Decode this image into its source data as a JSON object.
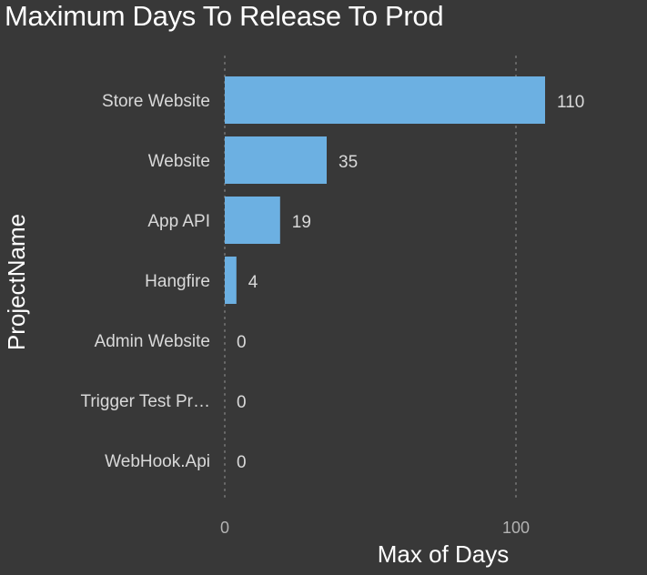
{
  "colors": {
    "background": "#383838",
    "bar": "#6cb0e2",
    "grid": "#6b6b6b",
    "text": "#d9d9d9",
    "title": "#ffffff"
  },
  "chart_data": {
    "type": "bar",
    "orientation": "horizontal",
    "title": "Maximum Days To Release To Prod",
    "xlabel": "Max of Days",
    "ylabel": "ProjectName",
    "categories": [
      "Store Website",
      "Website",
      "App API",
      "Hangfire",
      "Admin Website",
      "Trigger Test Pr…",
      "WebHook.Api"
    ],
    "values": [
      110,
      35,
      19,
      4,
      0,
      0,
      0
    ],
    "xlim": [
      0,
      125
    ],
    "xticks": [
      0,
      100
    ],
    "grid": "vertical dotted",
    "data_labels": true
  }
}
